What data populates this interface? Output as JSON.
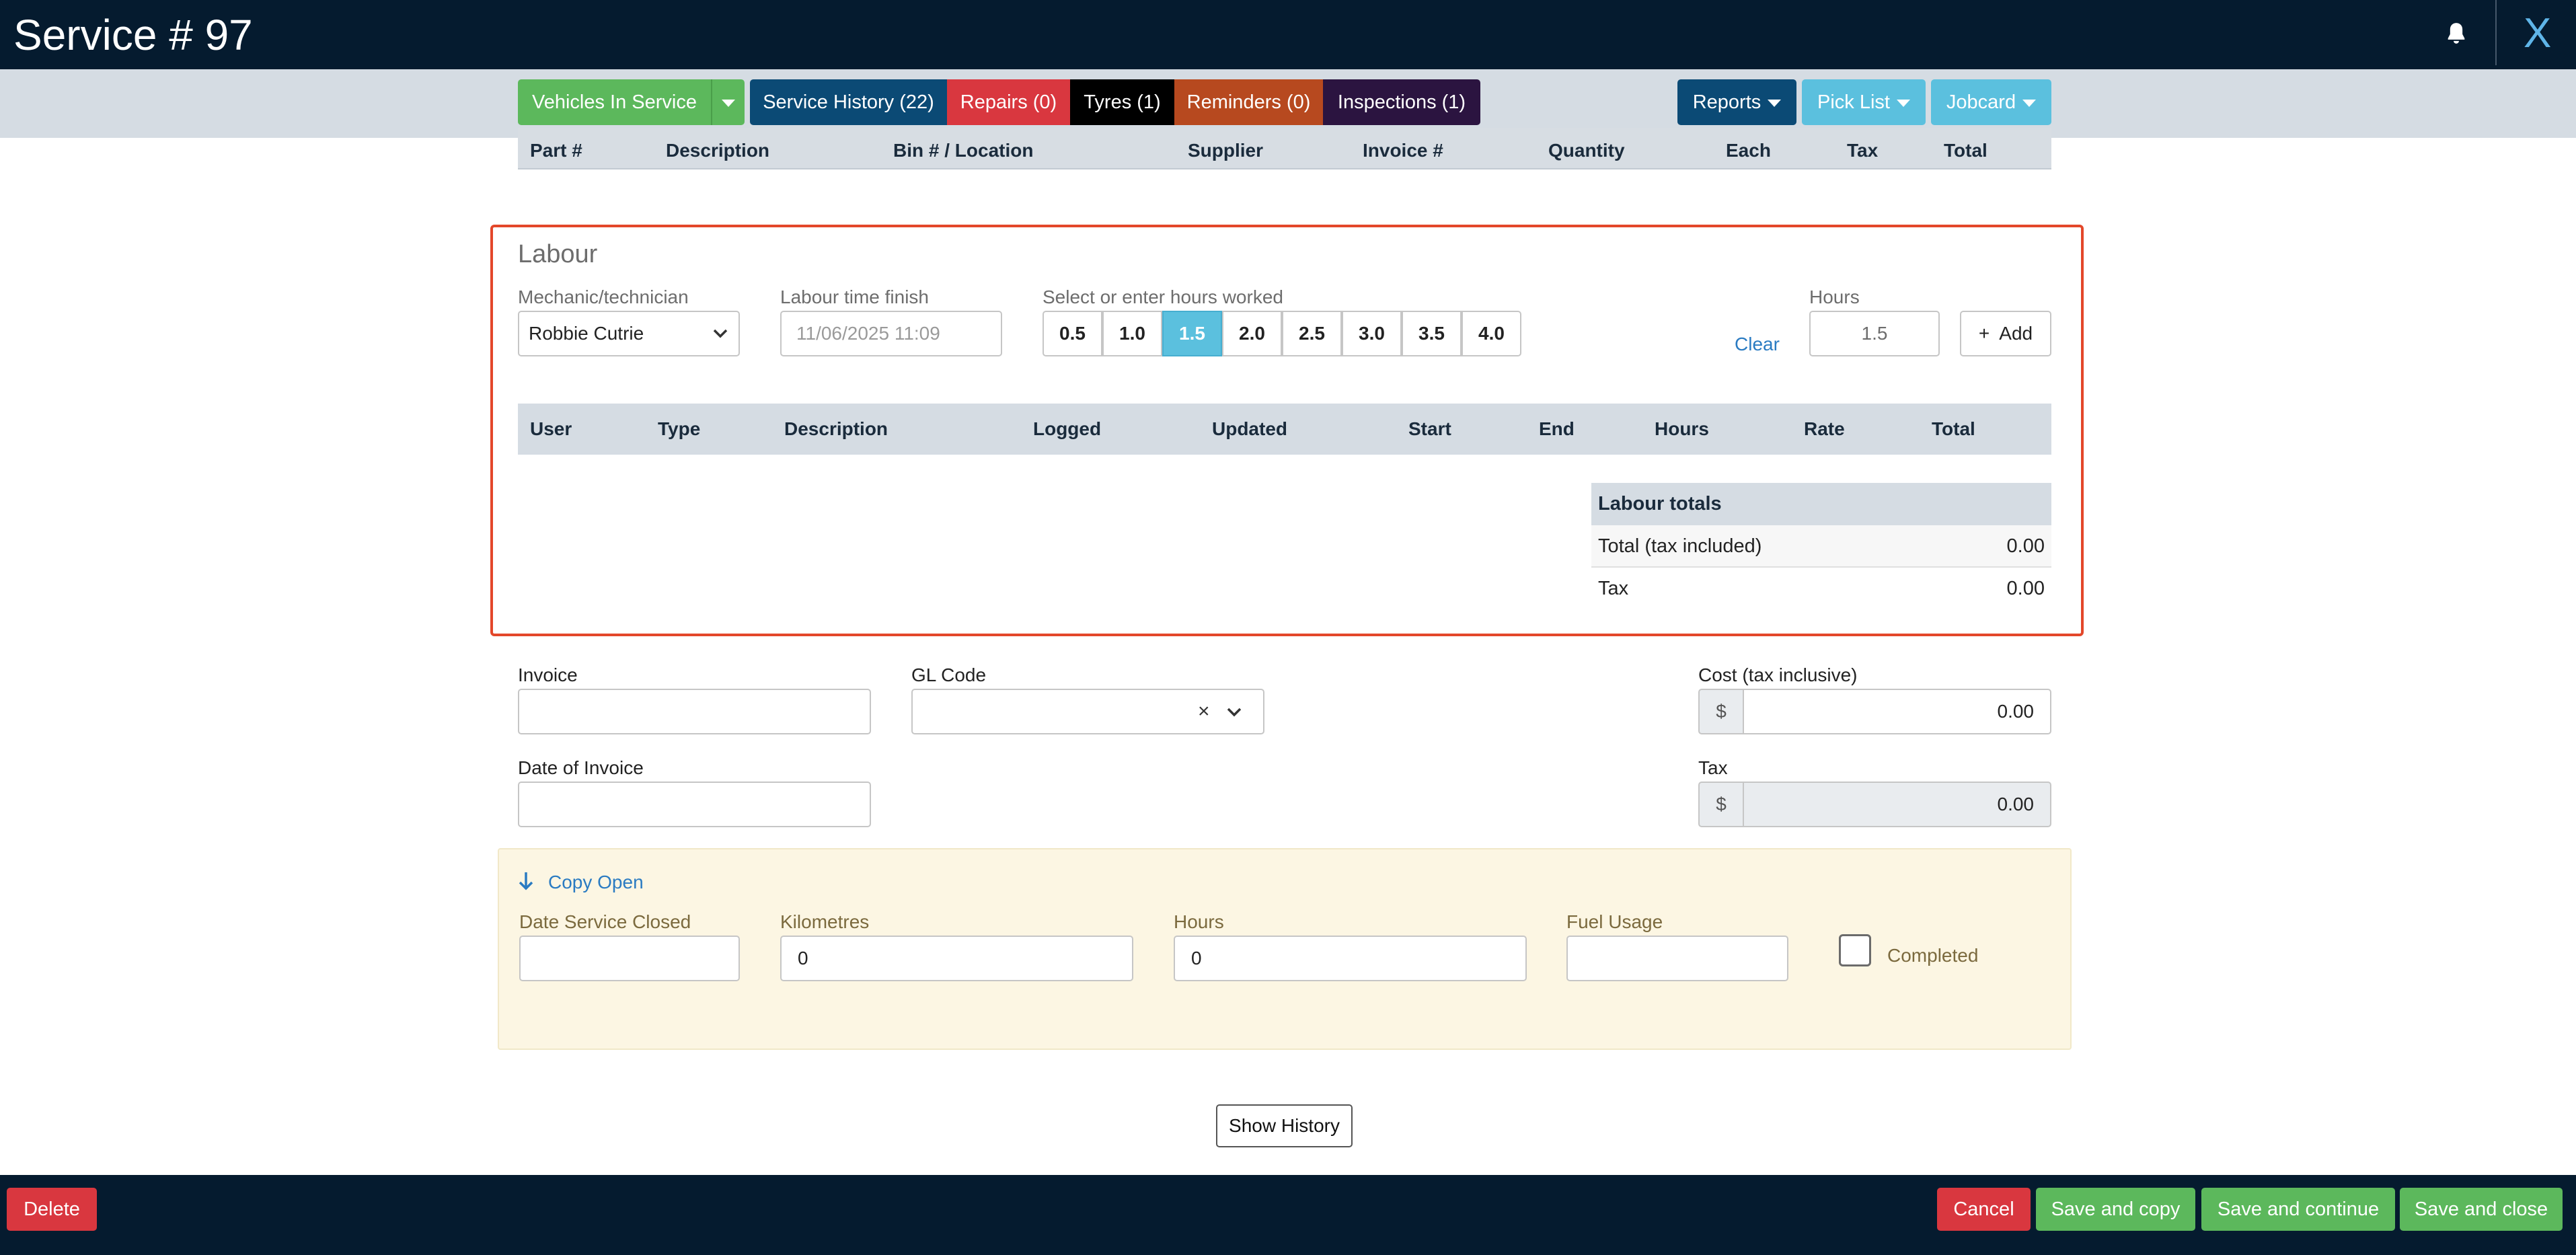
{
  "header": {
    "title": "Service # 97",
    "close_label": "X"
  },
  "nav": {
    "vehicles_in_service": "Vehicles In Service",
    "service_history": "Service History (22)",
    "repairs": "Repairs (0)",
    "tyres": "Tyres (1)",
    "reminders": "Reminders (0)",
    "inspections": "Inspections (1)",
    "reports": "Reports",
    "pick_list": "Pick List",
    "jobcard": "Jobcard"
  },
  "parts_table": {
    "columns": [
      "Part #",
      "Description",
      "Bin # / Location",
      "Supplier",
      "Invoice #",
      "Quantity",
      "Each",
      "Tax",
      "Total"
    ]
  },
  "labour": {
    "title": "Labour",
    "mechanic_label": "Mechanic/technician",
    "mechanic_value": "Robbie Cutrie",
    "finish_label": "Labour time finish",
    "finish_placeholder": "11/06/2025 11:09",
    "hours_select_label": "Select or enter hours worked",
    "hour_options": [
      "0.5",
      "1.0",
      "1.5",
      "2.0",
      "2.5",
      "3.0",
      "3.5",
      "4.0"
    ],
    "selected_hours": "1.5",
    "clear_label": "Clear",
    "hours_label": "Hours",
    "hours_value": "1.5",
    "add_label": "Add",
    "table_columns": [
      "User",
      "Type",
      "Description",
      "Logged",
      "Updated",
      "Start",
      "End",
      "Hours",
      "Rate",
      "Total"
    ],
    "totals": {
      "title": "Labour totals",
      "total_label": "Total (tax included)",
      "total_value": "0.00",
      "tax_label": "Tax",
      "tax_value": "0.00"
    }
  },
  "invoice": {
    "invoice_label": "Invoice",
    "invoice_value": "",
    "gl_code_label": "GL Code",
    "gl_code_value": "",
    "date_label": "Date of Invoice",
    "date_value": "",
    "cost_label": "Cost (tax inclusive)",
    "cost_prefix": "$",
    "cost_value": "0.00",
    "tax_label": "Tax",
    "tax_prefix": "$",
    "tax_value": "0.00"
  },
  "closing": {
    "copy_open_label": "Copy Open",
    "date_closed_label": "Date Service Closed",
    "date_closed_value": "",
    "km_label": "Kilometres",
    "km_value": "0",
    "hours_label": "Hours",
    "hours_value": "0",
    "fuel_label": "Fuel Usage",
    "fuel_value": "",
    "completed_label": "Completed"
  },
  "show_history_label": "Show History",
  "footer": {
    "delete": "Delete",
    "cancel": "Cancel",
    "save_copy": "Save and copy",
    "save_continue": "Save and continue",
    "save_close": "Save and close"
  },
  "colors": {
    "header_bg": "#051b2f",
    "nav_bg": "#d5dce3",
    "green": "#5cb85c",
    "navy": "#0b4a75",
    "red": "#d9373f",
    "black": "#000000",
    "orange": "#b7491f",
    "purple": "#2b1440",
    "sky": "#5bc0de",
    "labour_border": "#e3472a",
    "link_blue": "#2a7bc2"
  }
}
